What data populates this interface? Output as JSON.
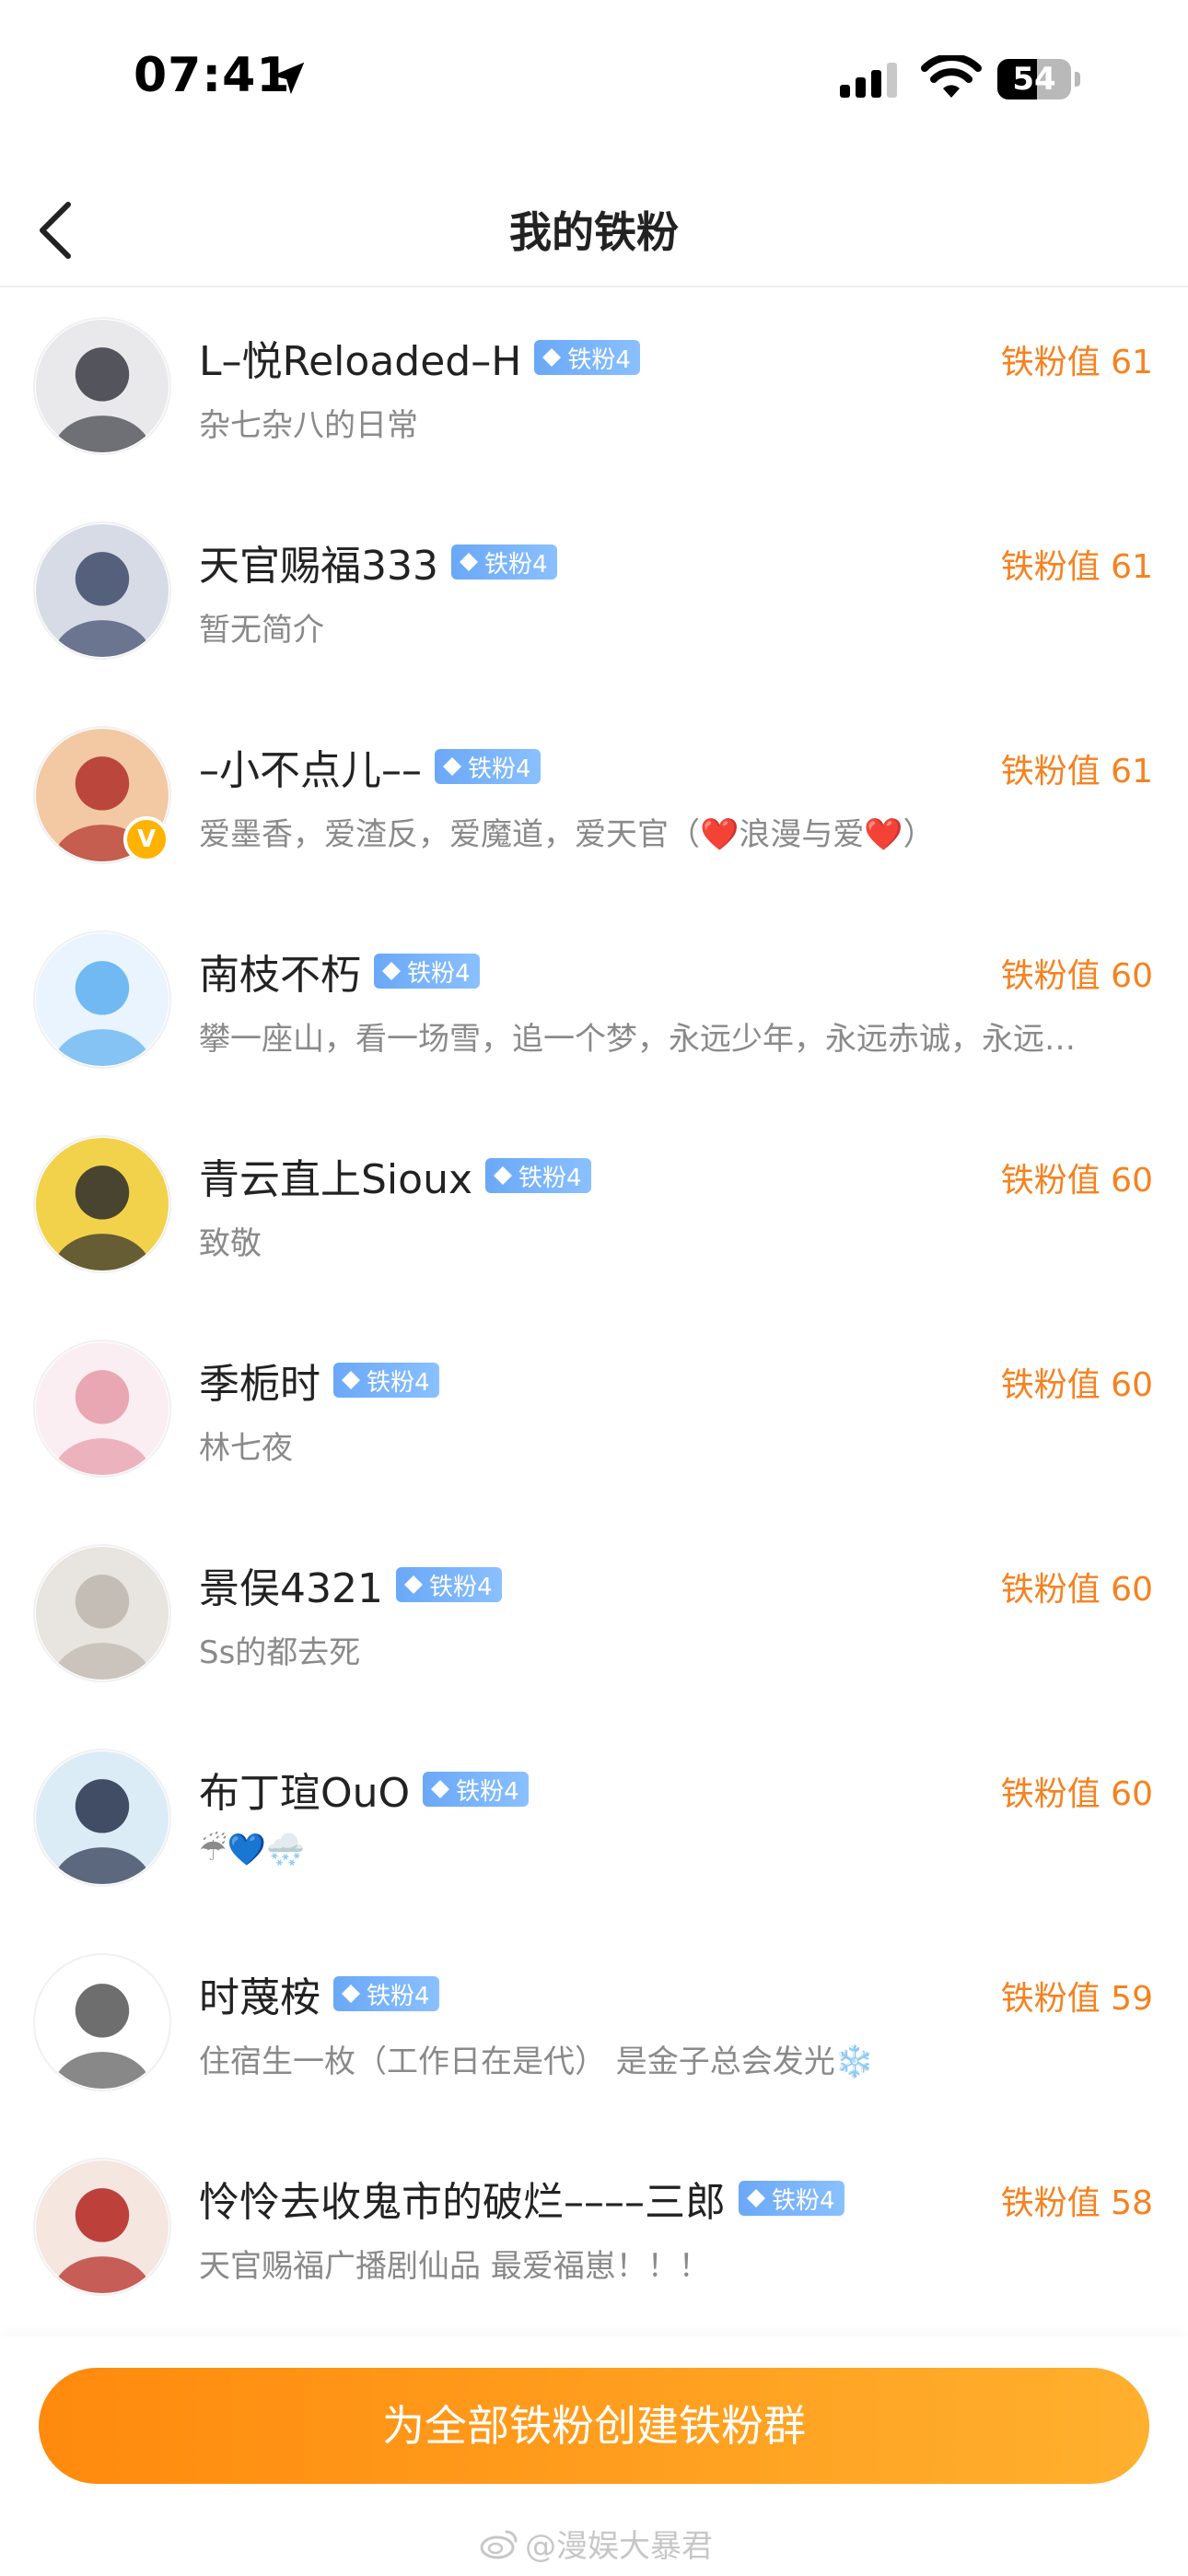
{
  "status_bar": {
    "time": "07:41",
    "battery": "54",
    "battery_level": 0.54
  },
  "nav": {
    "title": "我的铁粉"
  },
  "badge_label": "铁粉4",
  "fans": [
    {
      "name": "L–悦Reloaded–H",
      "bio": "杂七杂八的日常",
      "value": "铁粉值 61",
      "verified": false,
      "avatar_colors": [
        "#e9e9ec",
        "#3a3a44"
      ]
    },
    {
      "name": "天官赐福333",
      "bio": "暂无简介",
      "value": "铁粉值 61",
      "verified": false,
      "avatar_colors": [
        "#d7dbe6",
        "#3e4a6a"
      ]
    },
    {
      "name": "–小不点儿––",
      "bio": "爱墨香，爱渣反，爱魔道，爱天官（❤️浪漫与爱❤️）",
      "value": "铁粉值 61",
      "verified": true,
      "avatar_colors": [
        "#f3c9a3",
        "#b0302a"
      ]
    },
    {
      "name": "南枝不朽",
      "bio": "攀一座山，看一场雪，追一个梦，永远少年，永远赤诚，永远…",
      "value": "铁粉值 60",
      "verified": false,
      "avatar_colors": [
        "#e9f4ff",
        "#5aaef0"
      ]
    },
    {
      "name": "青云直上Sioux",
      "bio": "致敬",
      "value": "铁粉值 60",
      "verified": false,
      "avatar_colors": [
        "#f2d24a",
        "#2b2b2b"
      ]
    },
    {
      "name": "季栀时",
      "bio": "林七夜",
      "value": "铁粉值 60",
      "verified": false,
      "avatar_colors": [
        "#fbeef2",
        "#e59aa8"
      ]
    },
    {
      "name": "景俣4321",
      "bio": "Ss的都去死",
      "value": "铁粉值 60",
      "verified": false,
      "avatar_colors": [
        "#e8e4e0",
        "#bdb6ae"
      ]
    },
    {
      "name": "布丁瑄OuO",
      "bio": "☔💙🌨️",
      "value": "铁粉值 60",
      "verified": false,
      "avatar_colors": [
        "#dcecf7",
        "#25314a"
      ]
    },
    {
      "name": "时蔑桉",
      "bio": "住宿生一枚（工作日在是代） 是金子总会发光❄️",
      "value": "铁粉值 59",
      "verified": false,
      "avatar_colors": [
        "#ffffff",
        "#555555"
      ]
    },
    {
      "name": "怜怜去收鬼市的破烂––––三郎",
      "bio": "天官赐福广播剧仙品 最爱福崽！！！",
      "value": "铁粉值 58",
      "verified": false,
      "avatar_colors": [
        "#f6e6e0",
        "#b3221c"
      ]
    }
  ],
  "bottom": {
    "button_label": "为全部铁粉创建铁粉群",
    "watermark": "@漫娱大暴君"
  },
  "colors": {
    "accent": "#f58220",
    "badge": "#7ab4fa"
  }
}
